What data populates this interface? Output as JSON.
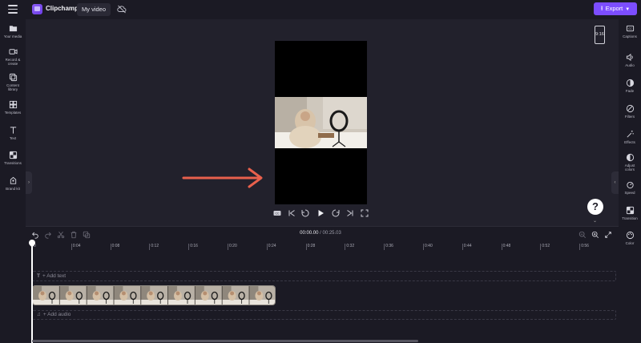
{
  "header": {
    "brand": "Clipchamp",
    "video_title": "My video",
    "export_label": "Export"
  },
  "left_nav": [
    {
      "label1": "Your media",
      "label2": "",
      "icon": "folder-icon"
    },
    {
      "label1": "Record &",
      "label2": "create",
      "icon": "video-camera-icon"
    },
    {
      "label1": "Content",
      "label2": "library",
      "icon": "library-icon"
    },
    {
      "label1": "Templates",
      "label2": "",
      "icon": "templates-icon"
    },
    {
      "label1": "Text",
      "label2": "",
      "icon": "text-icon"
    },
    {
      "label1": "Transitions",
      "label2": "",
      "icon": "transitions-icon"
    },
    {
      "label1": "Brand kit",
      "label2": "",
      "icon": "brand-kit-icon"
    }
  ],
  "right_nav": [
    {
      "label1": "Captions",
      "label2": "",
      "icon": "captions-icon"
    },
    {
      "label1": "Audio",
      "label2": "",
      "icon": "audio-icon"
    },
    {
      "label1": "Fade",
      "label2": "",
      "icon": "fade-icon"
    },
    {
      "label1": "Filters",
      "label2": "",
      "icon": "filters-icon"
    },
    {
      "label1": "Effects",
      "label2": "",
      "icon": "effects-icon"
    },
    {
      "label1": "Adjust",
      "label2": "colors",
      "icon": "adjust-colors-icon"
    },
    {
      "label1": "Speed",
      "label2": "",
      "icon": "speed-icon"
    },
    {
      "label1": "Transition",
      "label2": "",
      "icon": "transition-icon"
    },
    {
      "label1": "Color",
      "label2": "",
      "icon": "color-icon"
    }
  ],
  "preview": {
    "aspect_ratio": "9:16",
    "help_label": "?"
  },
  "timeline": {
    "current_time": "00:00.00",
    "total_time": "/ 00:25.03",
    "ruler_ticks": [
      "0",
      "0:04",
      "0:08",
      "0:12",
      "0:16",
      "0:20",
      "0:24",
      "0:28",
      "0:32",
      "0:36",
      "0:40",
      "0:44",
      "0:48",
      "0:52",
      "0:56"
    ],
    "add_text_label": "+ Add text",
    "add_audio_label": "+ Add audio"
  },
  "colors": {
    "accent": "#7c4dff",
    "arrow": "#e8604c"
  }
}
